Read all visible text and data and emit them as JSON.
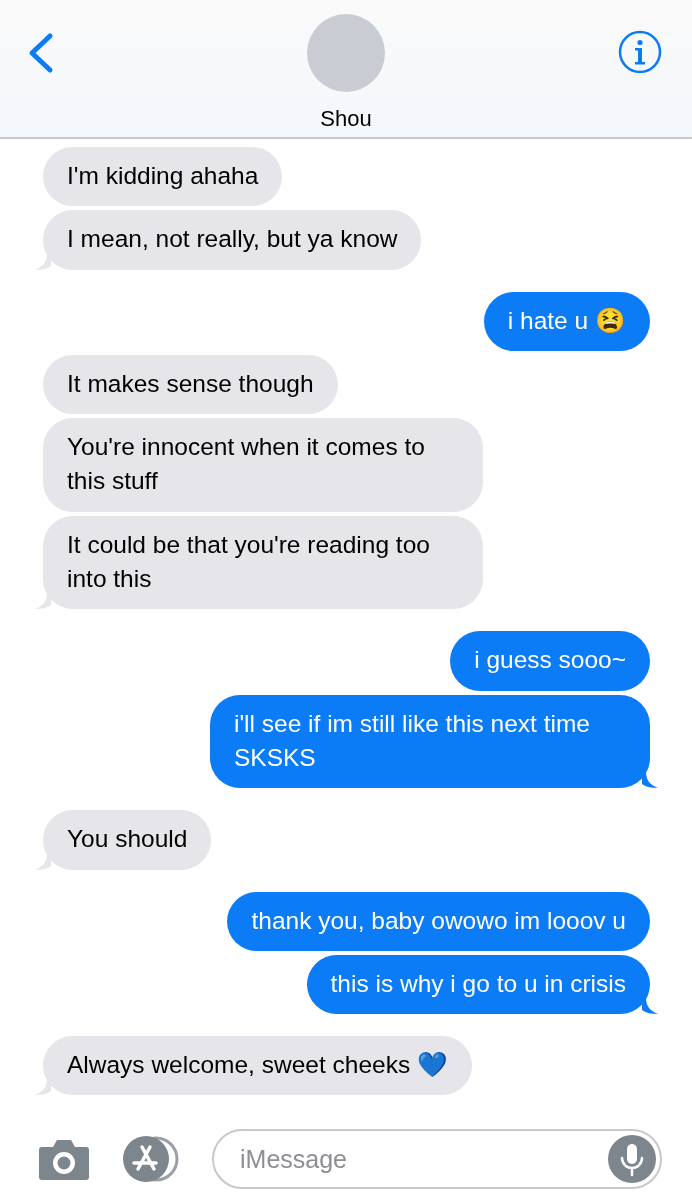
{
  "header": {
    "contact_name": "Shou"
  },
  "messages": [
    {
      "kind": "in",
      "text": "I'm kidding ahaha",
      "tail": false
    },
    {
      "kind": "in",
      "text": "I mean, not really, but ya know",
      "tail": true
    },
    {
      "kind": "out",
      "text": "i hate u 😫",
      "tail": false
    },
    {
      "kind": "in",
      "text": "It makes sense though",
      "tail": false
    },
    {
      "kind": "in",
      "text": "You're innocent when it comes to this stuff",
      "tail": false
    },
    {
      "kind": "in",
      "text": "It could be that you're reading too into this",
      "tail": true
    },
    {
      "kind": "out",
      "text": "i guess sooo~",
      "tail": false
    },
    {
      "kind": "out",
      "text": "i'll see if im still like this next time SKSKS",
      "tail": true
    },
    {
      "kind": "in",
      "text": "You should",
      "tail": true
    },
    {
      "kind": "out",
      "text": "thank you, baby owowo im looov u",
      "tail": false
    },
    {
      "kind": "out",
      "text": "this is why i go to u in crisis",
      "tail": true
    },
    {
      "kind": "in",
      "text": "Always welcome, sweet cheeks 💙",
      "tail": true
    }
  ],
  "composer": {
    "placeholder": "iMessage"
  }
}
